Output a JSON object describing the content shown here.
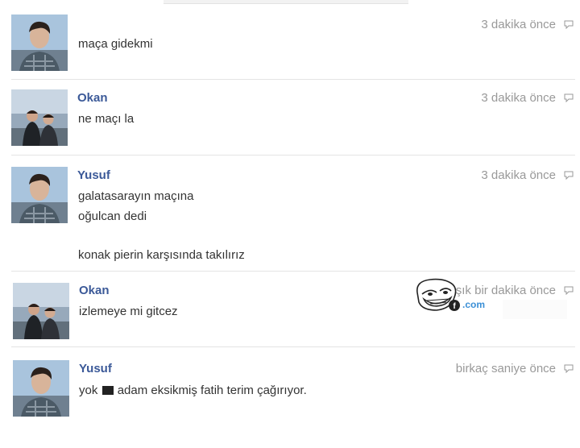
{
  "messages": [
    {
      "sender": "",
      "avatar": "boy",
      "lines": [
        "maça gidekmi"
      ],
      "time": "3 dakika önce"
    },
    {
      "sender": "Okan",
      "avatar": "couple",
      "lines": [
        "ne maçı la"
      ],
      "time": "3 dakika önce"
    },
    {
      "sender": "Yusuf",
      "avatar": "boy",
      "lines": [
        "galatasarayın maçına",
        "oğulcan dedi",
        "konak pierin karşısında takılırız"
      ],
      "time": "3 dakika önce"
    },
    {
      "sender": "Okan",
      "avatar": "couple",
      "lines": [
        "izlemeye mi gitcez"
      ],
      "time": "aşık bir dakika önce"
    },
    {
      "sender": "Yusuf",
      "avatar": "boy",
      "lines": [
        "yok",
        "adam eksikmiş fatih terim çağırıyor."
      ],
      "time": "birkaç saniye önce"
    }
  ],
  "watermark": {
    "text": ".com",
    "icon": "troll-face-icon"
  },
  "icons": {
    "reply": "reply-icon"
  }
}
